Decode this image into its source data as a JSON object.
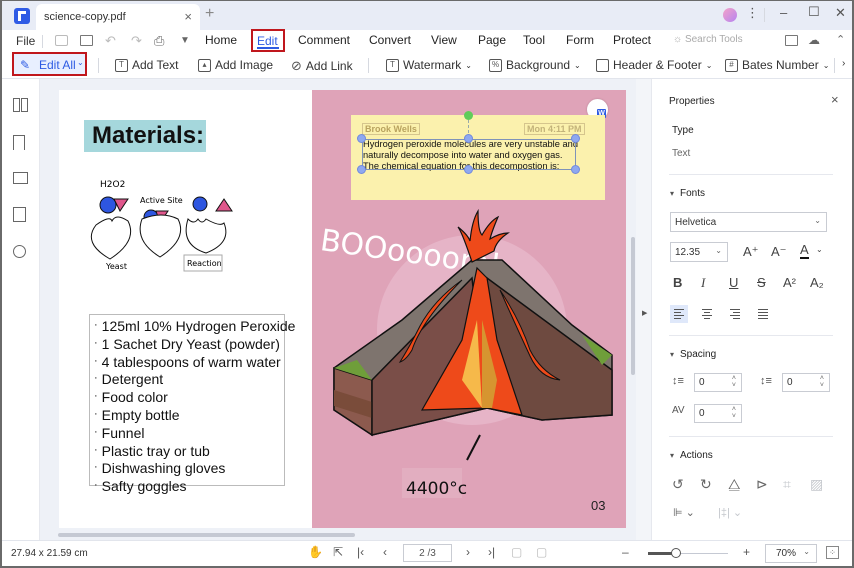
{
  "window": {
    "tab_title": "science-copy.pdf",
    "tab_close": "×",
    "new_tab": "+",
    "controls": {
      "more": "⋮",
      "minimize": "–",
      "maximize": "☐",
      "close": "✕"
    }
  },
  "menu": {
    "file": "File",
    "items": [
      "Home",
      "Edit",
      "Comment",
      "Convert",
      "View",
      "Page",
      "Tool",
      "Form",
      "Protect"
    ],
    "active": "Edit",
    "search_placeholder": "Search Tools"
  },
  "toolbar": {
    "edit_all": "Edit All",
    "add_text": "Add Text",
    "add_image": "Add Image",
    "add_link": "Add Link",
    "watermark": "Watermark",
    "background": "Background",
    "header_footer": "Header & Footer",
    "bates_number": "Bates Number"
  },
  "left_sidebar": {
    "icons": [
      "thumbnails-icon",
      "bookmark-icon",
      "comment-icon",
      "attachment-icon",
      "search-icon"
    ]
  },
  "document": {
    "left_page": {
      "heading": "Materials:",
      "diagram_labels": {
        "h2o2": "H2O2",
        "active_site": "Active Site",
        "yeast": "Yeast",
        "reaction": "Reaction"
      },
      "materials": [
        "125ml 10% Hydrogen Peroxide",
        "1 Sachet Dry Yeast (powder)",
        "4 tablespoons of warm water",
        "Detergent",
        "Food color",
        "Empty bottle",
        "Funnel",
        "Plastic tray or tub",
        "Dishwashing gloves",
        "Safty goggles"
      ]
    },
    "right_page": {
      "note": {
        "author": "Brook Wells",
        "time": "Mon 4:11 PM",
        "text": "Hydrogen peroxide molecules are very unstable and naturally decompose into water and oxygen gas. The chemical equation for this decompostion is:"
      },
      "boom_text": "BOOoooom!",
      "temperature": "4400°c",
      "page_number": "03"
    },
    "colors": {
      "page_pink": "#dfa3b8",
      "note_yellow": "#fbf1ad",
      "heading_bg": "#a5d7dc",
      "accent": "#2d5be3",
      "highlight_red": "#c0171d"
    }
  },
  "properties": {
    "title": "Properties",
    "close": "×",
    "type_label": "Type",
    "type_value": "Text",
    "fonts_section": "Fonts",
    "font_family": "Helvetica",
    "font_size": "12.35",
    "format_buttons": [
      "B",
      "I",
      "U",
      "S",
      "A²",
      "A₂"
    ],
    "spacing_section": "Spacing",
    "line_spacing": "0",
    "paragraph_spacing": "0",
    "char_spacing": "0",
    "actions_section": "Actions"
  },
  "status": {
    "dimensions": "27.94 x 21.59 cm",
    "current_page": "2",
    "total_pages": "/3",
    "page_display": "2 /3",
    "zoom": "70%",
    "zoom_slider_fraction": 0.35
  }
}
